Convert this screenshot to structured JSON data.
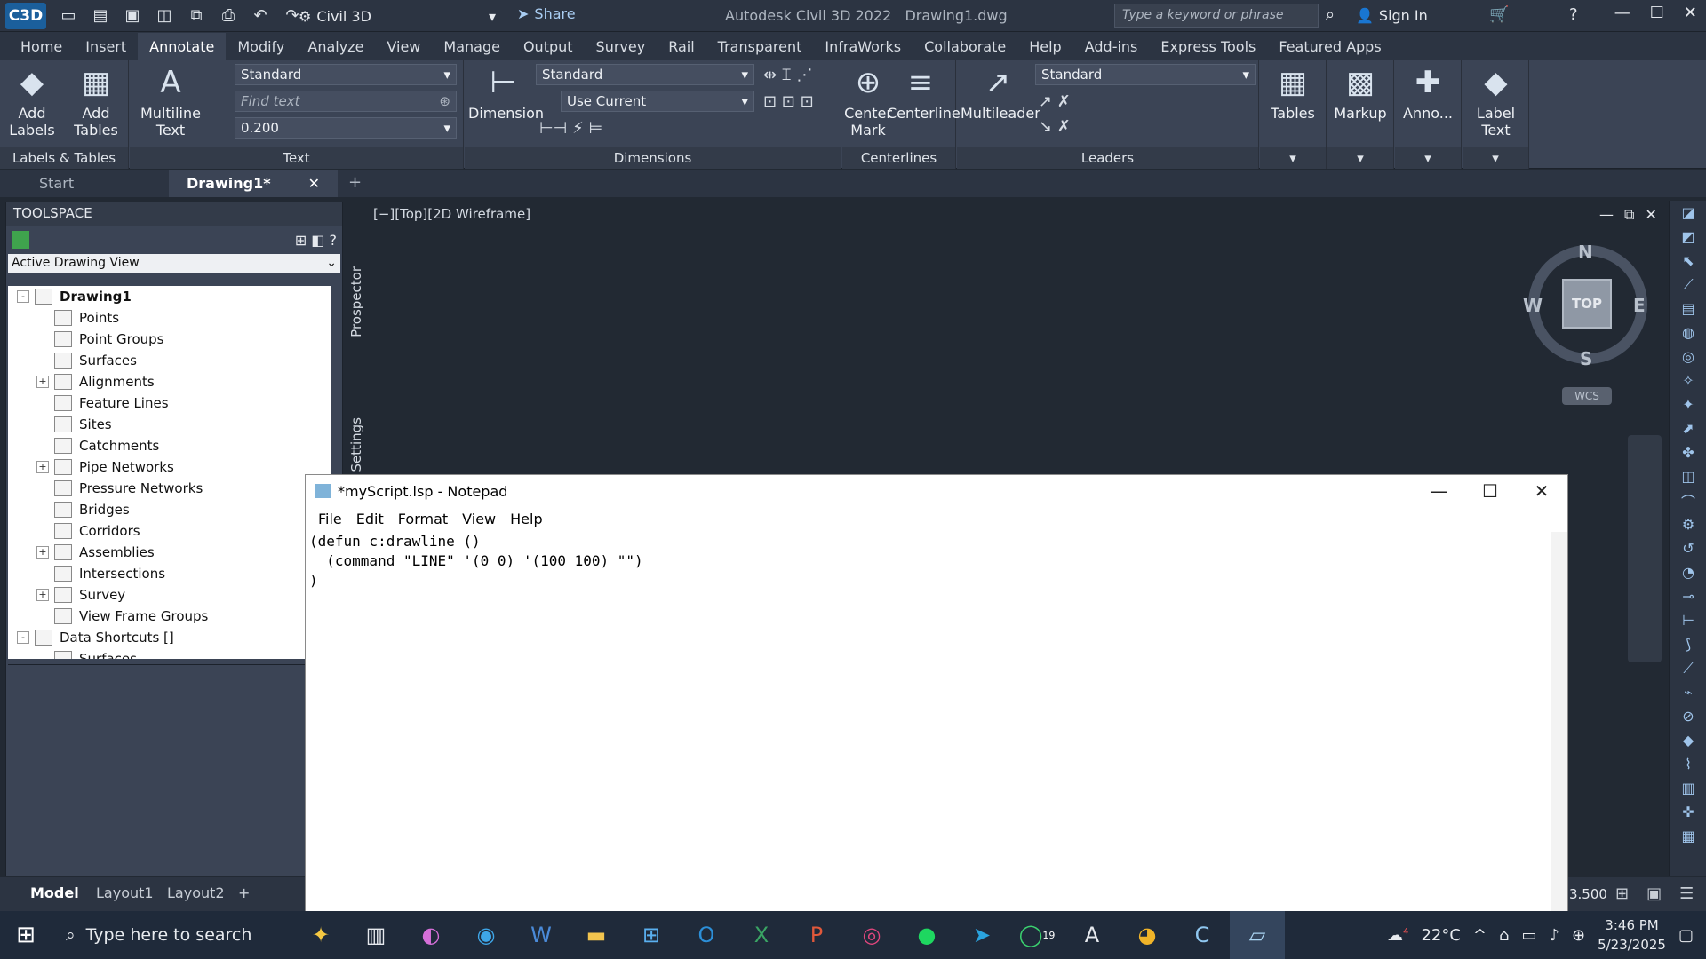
{
  "titlebar": {
    "logo": "C3D",
    "workspace": "Civil 3D",
    "share": "Share",
    "app_title": "Autodesk Civil 3D 2022",
    "file_title": "Drawing1.dwg",
    "search_placeholder": "Type a keyword or phrase",
    "signin": "Sign In"
  },
  "ribbon_tabs": [
    "Home",
    "Insert",
    "Annotate",
    "Modify",
    "Analyze",
    "View",
    "Manage",
    "Output",
    "Survey",
    "Rail",
    "Transparent",
    "InfraWorks",
    "Collaborate",
    "Help",
    "Add-ins",
    "Express Tools",
    "Featured Apps"
  ],
  "ribbon": {
    "labels_tables": {
      "add_labels": "Add Labels",
      "add_tables": "Add Tables",
      "panel": "Labels & Tables"
    },
    "text": {
      "multiline": "Multiline Text",
      "style": "Standard",
      "find_placeholder": "Find text",
      "height": "0.200",
      "panel": "Text"
    },
    "dimensions": {
      "dimension": "Dimension",
      "style": "Standard",
      "layer": "Use Current",
      "panel": "Dimensions"
    },
    "centerlines": {
      "center_mark": "Center Mark",
      "centerline": "Centerline",
      "panel": "Centerlines"
    },
    "leaders": {
      "multileader": "Multileader",
      "style": "Standard",
      "panel": "Leaders"
    },
    "extra": {
      "tables": "Tables",
      "markup": "Markup",
      "anno": "Anno...",
      "label_text": "Label Text"
    }
  },
  "doc_tabs": {
    "start": "Start",
    "drawing": "Drawing1*"
  },
  "toolspace": {
    "title": "TOOLSPACE",
    "view": "Active Drawing View",
    "prospector": "Prospector",
    "settings": "Settings",
    "tree": [
      {
        "label": "Drawing1",
        "exp": "-",
        "level": 0
      },
      {
        "label": "Points",
        "exp": "",
        "level": 1
      },
      {
        "label": "Point Groups",
        "exp": "",
        "level": 1
      },
      {
        "label": "Surfaces",
        "exp": "",
        "level": 1
      },
      {
        "label": "Alignments",
        "exp": "+",
        "level": 1
      },
      {
        "label": "Feature Lines",
        "exp": "",
        "level": 1
      },
      {
        "label": "Sites",
        "exp": "",
        "level": 1
      },
      {
        "label": "Catchments",
        "exp": "",
        "level": 1
      },
      {
        "label": "Pipe Networks",
        "exp": "+",
        "level": 1
      },
      {
        "label": "Pressure Networks",
        "exp": "",
        "level": 1
      },
      {
        "label": "Bridges",
        "exp": "",
        "level": 1
      },
      {
        "label": "Corridors",
        "exp": "",
        "level": 1
      },
      {
        "label": "Assemblies",
        "exp": "+",
        "level": 1
      },
      {
        "label": "Intersections",
        "exp": "",
        "level": 1
      },
      {
        "label": "Survey",
        "exp": "+",
        "level": 1
      },
      {
        "label": "View Frame Groups",
        "exp": "",
        "level": 1
      },
      {
        "label": "Data Shortcuts []",
        "exp": "-",
        "level": 0
      },
      {
        "label": "Surfaces",
        "exp": "",
        "level": 1
      }
    ]
  },
  "viewport": {
    "label": "[−][Top][2D Wireframe]",
    "cube": "TOP",
    "n": "N",
    "s": "S",
    "e": "E",
    "w": "W",
    "wcs": "WCS"
  },
  "status": {
    "model": "Model",
    "layout1": "Layout1",
    "layout2": "Layout2",
    "scale": "3.500"
  },
  "notepad": {
    "title": "*myScript.lsp - Notepad",
    "menu": [
      "File",
      "Edit",
      "Format",
      "View",
      "Help"
    ],
    "content": "(defun c:drawline ()\n  (command \"LINE\" '(0 0) '(100 100) \"\")\n)"
  },
  "taskbar": {
    "search_placeholder": "Type here to search",
    "temperature": "22°C",
    "time": "3:46 PM",
    "date": "5/23/2025",
    "whatsapp_badge": "19",
    "weather_badge": "4"
  }
}
